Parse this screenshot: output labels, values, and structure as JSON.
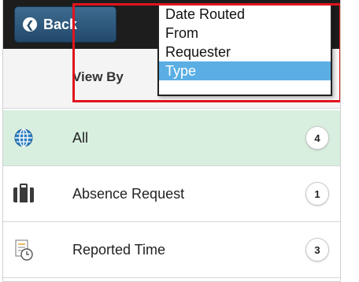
{
  "header": {
    "back_label": "Back",
    "back_icon": "chevron-left-icon"
  },
  "view_by": {
    "label": "View By",
    "options": [
      "Date Routed",
      "From",
      "Requester",
      "Type"
    ],
    "selected": "Type"
  },
  "list": {
    "items": [
      {
        "label": "All",
        "count": "4",
        "icon": "globe-icon",
        "selected": true
      },
      {
        "label": "Absence Request",
        "count": "1",
        "icon": "briefcase-icon",
        "selected": false
      },
      {
        "label": "Reported Time",
        "count": "3",
        "icon": "timesheet-clock-icon",
        "selected": false
      }
    ]
  },
  "colors": {
    "header_bg": "#1d1d1d",
    "back_button": "#2b5576",
    "selected_row": "#d8efdf",
    "dropdown_selected": "#5aaee3",
    "highlight": "#e0141e"
  }
}
